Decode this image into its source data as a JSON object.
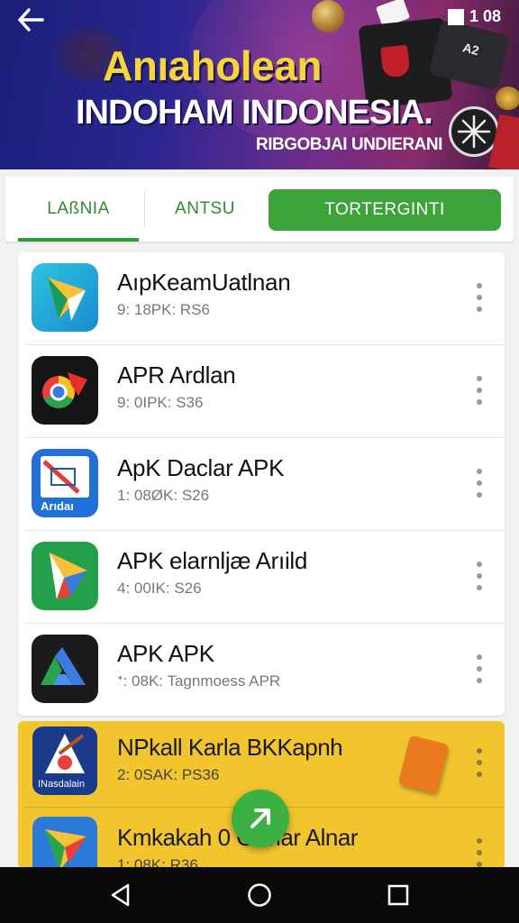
{
  "banner": {
    "title_line1": "Anıaholean",
    "title_line2": "INDOHAM INDONESIA.",
    "title_line3": "RIBGOBJAI UNDIERANI",
    "wallet_tag": "A2",
    "status_time": "1 08",
    "colors": {
      "title_yellow": "#f5d63a",
      "background_start": "#1a1f78",
      "background_end": "#8a2c6c"
    }
  },
  "tabs": [
    {
      "label": "LAßNIA",
      "active": true
    },
    {
      "label": "ANTSU",
      "active": false
    },
    {
      "label": "TORTERGINTI",
      "active": false,
      "style": "filled-green"
    }
  ],
  "apps": [
    {
      "name": "AıpKeamUatlnan",
      "meta": "9: 18PK: RS6",
      "icon": "triangle-play-icon"
    },
    {
      "name": "APR Ardlan",
      "meta": "9: 0IPK: S36",
      "icon": "chrome-arrow-icon"
    },
    {
      "name": "ApK Daclar APK",
      "meta": "1: 08ØK: S26",
      "icon": "document-arrow-icon",
      "icon_text": "Arıdaı"
    },
    {
      "name": "APK elarnljæ Arıild",
      "meta": "4: 00IK: S26",
      "icon": "green-triangle-icon"
    },
    {
      "name": "APK APK",
      "meta": "ᕀ: 08K: Tagnmoess APR",
      "icon": "drive-arrow-icon"
    }
  ],
  "featured_apps": [
    {
      "name": "NPkall Karla BKKapnh",
      "meta": "2: 0SAK: PS36",
      "icon": "shield-download-icon",
      "icon_text": "INasdalain"
    },
    {
      "name": "Kmkakah 0 Grmar Alnar",
      "meta": "1: 08K: R36",
      "icon": "blue-triangle-icon"
    }
  ],
  "fab": {
    "icon": "arrow-up-right-icon",
    "color": "#3cb043"
  },
  "navbar": {
    "back": "nav-back-icon",
    "home": "nav-home-icon",
    "recent": "nav-recents-icon"
  },
  "accent_green": "#3ea33a"
}
